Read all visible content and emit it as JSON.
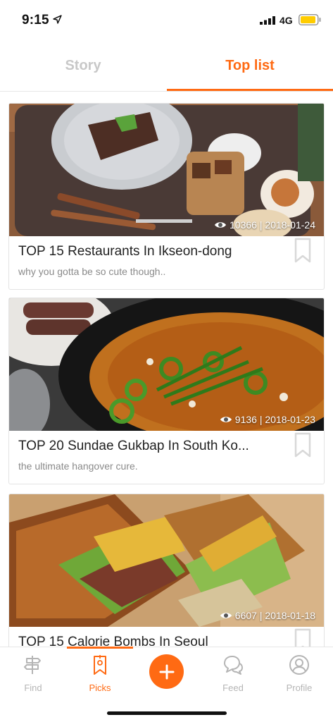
{
  "status": {
    "time": "9:15",
    "network": "4G"
  },
  "tabs": [
    {
      "label": "Story",
      "active": false
    },
    {
      "label": "Top list",
      "active": true
    }
  ],
  "colors": {
    "accent": "#ff6a13",
    "inactive": "#c8c8c8"
  },
  "cards": [
    {
      "views": "10366",
      "date": "2018-01-24",
      "title": "TOP 15 Restaurants In Ikseon-dong",
      "subtitle": "why you gotta be so cute though.."
    },
    {
      "views": "9136",
      "date": "2018-01-23",
      "title": "TOP 20 Sundae Gukbap In South Ko...",
      "subtitle": "the ultimate hangover cure."
    },
    {
      "views": "6607",
      "date": "2018-01-18",
      "title": "TOP 15 Calorie Bombs In Seoul",
      "subtitle": ""
    }
  ],
  "nav": {
    "items": [
      {
        "label": "Find",
        "icon": "signpost-icon",
        "active": false
      },
      {
        "label": "Picks",
        "icon": "bookmark-icon",
        "active": true
      },
      {
        "label": "",
        "icon": "plus-icon",
        "active": false
      },
      {
        "label": "Feed",
        "icon": "chat-bubbles-icon",
        "active": false
      },
      {
        "label": "Profile",
        "icon": "person-icon",
        "active": false
      }
    ]
  }
}
